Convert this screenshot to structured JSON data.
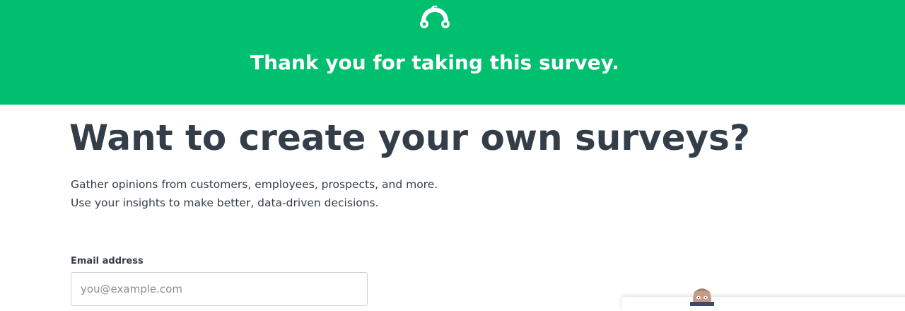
{
  "header": {
    "logo_icon": "surveymonkey-logo-icon",
    "thanks": "Thank you for taking this survey.",
    "background_color": "#00bf6f"
  },
  "promo": {
    "headline": "Want to create your own surveys?",
    "description_line1": "Gather opinions from customers, employees, prospects, and more.",
    "description_line2": "Use your insights to make better, data-driven decisions."
  },
  "signup": {
    "email_label": "Email address",
    "email_placeholder": "you@example.com",
    "email_value": ""
  },
  "illustration": {
    "icon": "person-photo-icon"
  }
}
